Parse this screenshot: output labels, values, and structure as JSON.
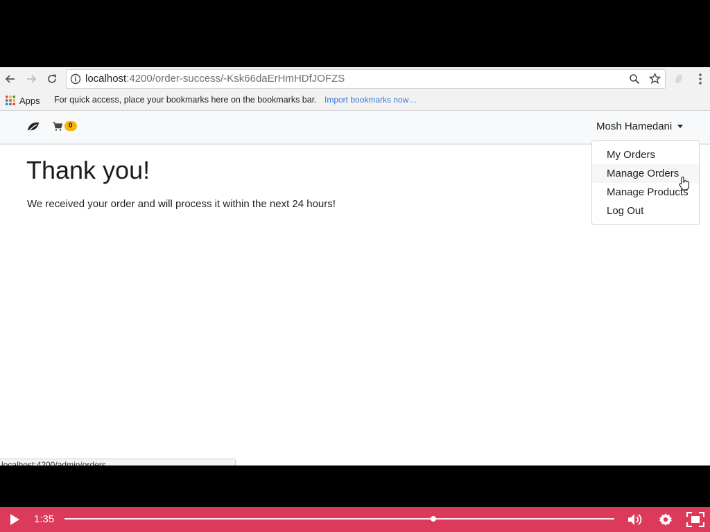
{
  "browser": {
    "url_host": "localhost",
    "url_rest": ":4200/order-success/-Ksk66daErHmHDfJOFZS",
    "bookmarks_apps_label": "Apps",
    "bookmarks_hint": "For quick access, place your bookmarks here on the bookmarks bar.",
    "bookmarks_import": "Import bookmarks now…",
    "status_url": "localhost:4200/admin/orders"
  },
  "navbar": {
    "cart_count": "0",
    "user_name": "Mosh Hamedani",
    "dropdown_items": [
      "My Orders",
      "Manage Orders",
      "Manage Products",
      "Log Out"
    ],
    "hovered_item": "Manage Orders"
  },
  "page": {
    "heading": "Thank you!",
    "message": "We received your order and will process it within the next 24 hours!"
  },
  "player": {
    "time": "1:35",
    "progress": 0.671,
    "accent_color": "#dc3a5a"
  },
  "icons": [
    "back-arrow-icon",
    "forward-arrow-icon",
    "reload-icon",
    "info-icon",
    "zoom-icon",
    "star-icon",
    "extension-icon",
    "menu-dots-icon",
    "apps-grid-icon",
    "leaf-icon",
    "cart-icon",
    "play-icon",
    "volume-icon",
    "settings-icon",
    "fullscreen-icon"
  ]
}
